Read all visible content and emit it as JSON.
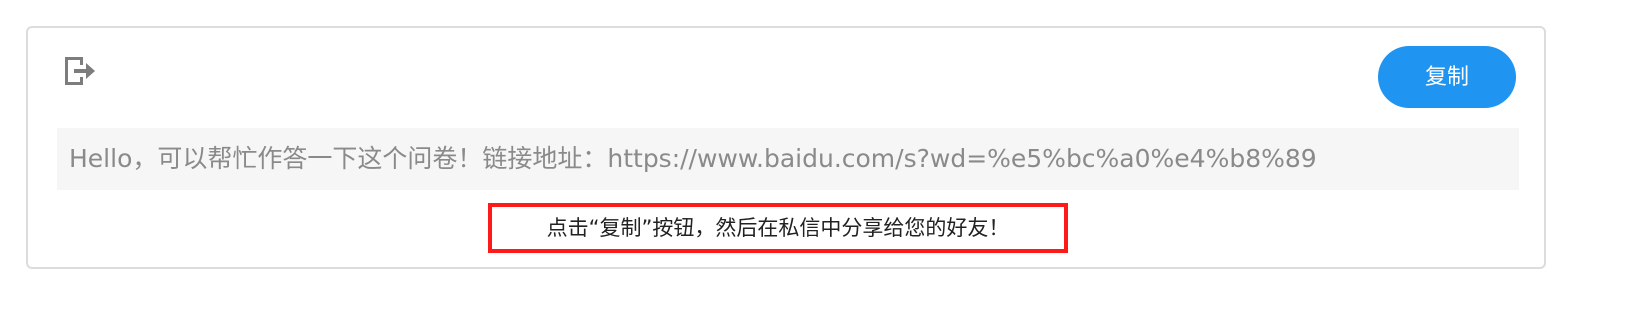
{
  "share_panel": {
    "icon": "exit-icon",
    "copy_button_label": "复制",
    "link_text": "Hello，可以帮忙作答一下这个问卷！链接地址：https://www.baidu.com/s?wd=%e5%bc%a0%e4%b8%89",
    "hint_text": "点击“复制”按钮，然后在私信中分享给您的好友！",
    "colors": {
      "button_bg": "#1f94f0",
      "hint_border": "#ff1a1a",
      "link_bg": "#f6f6f6"
    }
  }
}
